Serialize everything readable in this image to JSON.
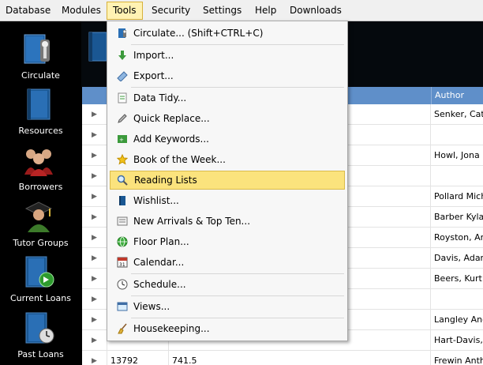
{
  "menubar": {
    "items": [
      {
        "label": "Database"
      },
      {
        "label": "Modules"
      },
      {
        "label": "Tools"
      },
      {
        "label": "Security"
      },
      {
        "label": "Settings"
      },
      {
        "label": "Help"
      },
      {
        "label": "Downloads"
      }
    ],
    "active": "Tools"
  },
  "sidebar": {
    "items": [
      {
        "label": "Circulate",
        "icon": "circulate-icon"
      },
      {
        "label": "Resources",
        "icon": "book-icon"
      },
      {
        "label": "Borrowers",
        "icon": "people-icon"
      },
      {
        "label": "Tutor Groups",
        "icon": "graduate-icon"
      },
      {
        "label": "Current Loans",
        "icon": "book-arrow-icon"
      },
      {
        "label": "Past Loans",
        "icon": "book-clock-icon"
      }
    ]
  },
  "tools_menu": {
    "items": [
      {
        "label": "Circulate... (Shift+CTRL+C)",
        "icon": "scanner-icon"
      },
      {
        "label": "Import...",
        "icon": "import-arrow-icon"
      },
      {
        "label": "Export...",
        "icon": "export-icon"
      },
      {
        "label": "Data Tidy...",
        "icon": "data-tidy-icon"
      },
      {
        "label": "Quick Replace...",
        "icon": "pen-icon"
      },
      {
        "label": "Add Keywords...",
        "icon": "keywords-icon"
      },
      {
        "label": "Book of the Week...",
        "icon": "star-icon"
      },
      {
        "label": "Reading Lists",
        "icon": "magnifier-icon"
      },
      {
        "label": "Wishlist...",
        "icon": "wishlist-book-icon"
      },
      {
        "label": "New Arrivals & Top Ten...",
        "icon": "newspaper-icon"
      },
      {
        "label": "Floor Plan...",
        "icon": "globe-icon"
      },
      {
        "label": "Calendar...",
        "icon": "calendar-icon"
      },
      {
        "label": "Schedule...",
        "icon": "clock-icon"
      },
      {
        "label": "Views...",
        "icon": "views-icon"
      },
      {
        "label": "Housekeeping...",
        "icon": "broom-icon"
      }
    ],
    "highlighted": "Reading Lists",
    "calendar_day": "31"
  },
  "grid": {
    "columns": [
      "",
      "",
      "Author"
    ],
    "rows": [
      {
        "accession": "",
        "classification": "",
        "author": "Senker, Cat"
      },
      {
        "accession": "",
        "classification": "",
        "author": ""
      },
      {
        "accession": "",
        "classification": "",
        "author": "Howl, Jona"
      },
      {
        "accession": "",
        "classification": "",
        "author": ""
      },
      {
        "accession": "",
        "classification": "",
        "author": "Pollard Mich"
      },
      {
        "accession": "",
        "classification": "",
        "author": "Barber Kyla"
      },
      {
        "accession": "",
        "classification": "",
        "author": "Royston, An"
      },
      {
        "accession": "",
        "classification": "",
        "author": "Davis, Adam"
      },
      {
        "accession": "",
        "classification": "",
        "author": "Beers, Kurt"
      },
      {
        "accession": "",
        "classification": "",
        "author": ""
      },
      {
        "accession": "",
        "classification": "",
        "author": "Langley And"
      },
      {
        "accession": "",
        "classification": "",
        "author": "Hart-Davis,"
      },
      {
        "accession": "13792",
        "classification": "741.5",
        "author": "Frewin Anth"
      }
    ]
  },
  "colors": {
    "menu_highlight": "#fbe37d",
    "header_blue": "#5f8fc9",
    "menubar_bg": "#f0f0f0"
  }
}
